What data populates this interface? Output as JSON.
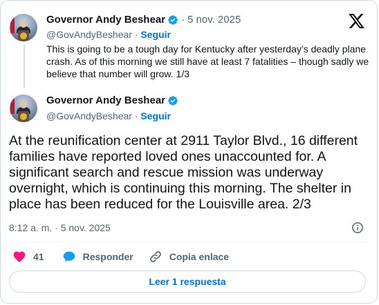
{
  "first_tweet": {
    "author_name": "Governor Andy Beshear",
    "separator": "·",
    "date": "5 nov. 2025",
    "handle": "@GovAndyBeshear",
    "dot": " · ",
    "follow_label": "Seguir",
    "text": "This is going to be a tough day for Kentucky after yesterday’s deadly plane crash. As of this morning we still have at least 7 fatalities – though sadly we believe that number will grow. 1/3"
  },
  "main_tweet": {
    "author_name": "Governor Andy Beshear",
    "handle": "@GovAndyBeshear",
    "dot": " · ",
    "follow_label": "Seguir",
    "text": "At the reunification center at 2911 Taylor Blvd., 16 different families have reported loved ones unaccounted for. A significant search and rescue mission was underway overnight, which is continuing this morning. The shelter in place has been reduced for the Louisville area. 2/3",
    "timestamp": "8:12 a. m. · 5 nov. 2025"
  },
  "actions": {
    "like_count": "41",
    "reply_label": "Responder",
    "copy_link_label": "Copia enlace"
  },
  "read_replies_label": "Leer 1 respuesta",
  "icons": {
    "verified": "verified-badge-icon",
    "logo": "x-logo-icon",
    "info": "info-icon",
    "like": "heart-icon",
    "reply": "speech-bubble-icon",
    "link": "link-icon"
  },
  "colors": {
    "link_blue": "#006fd6",
    "verified_blue": "#1d9bf0",
    "heart_red": "#f91880",
    "muted_text": "#536471"
  }
}
